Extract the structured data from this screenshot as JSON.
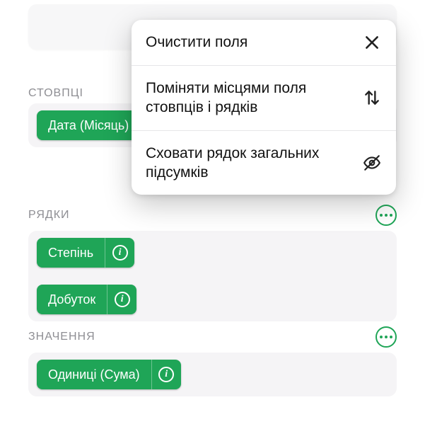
{
  "sections": {
    "columns": {
      "title": "СТОВПЦІ"
    },
    "rows": {
      "title": "РЯДКИ"
    },
    "values": {
      "title": "ЗНАЧЕННЯ"
    }
  },
  "fields": {
    "column0": "Дата (Місяць)",
    "row0": "Степінь",
    "row1": "Добуток",
    "value0": "Одиниці (Сума)"
  },
  "menu": {
    "clear": "Очистити поля",
    "swap": "Поміняти місцями поля стовпців і рядків",
    "hide": "Сховати рядок загальних підсумків"
  }
}
